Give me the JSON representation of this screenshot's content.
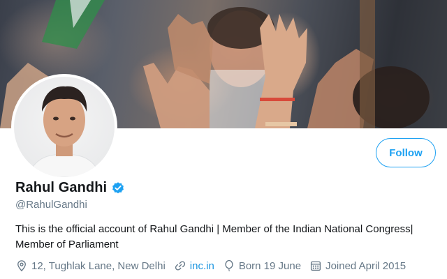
{
  "profile": {
    "name": "Rahul Gandhi",
    "handle": "@RahulGandhi",
    "bio": "This is the official account of Rahul Gandhi | Member of the Indian National Congress| Member of Parliament",
    "verified": true,
    "follow_label": "Follow",
    "location": "12, Tughlak Lane, New Delhi",
    "website": "inc.in",
    "birthday": "Born 19 June",
    "joined": "Joined April 2015"
  },
  "icons": {
    "verified": "verified-badge-icon",
    "location": "location-pin-icon",
    "website": "link-icon",
    "birthday": "balloon-icon",
    "joined": "calendar-icon"
  },
  "colors": {
    "accent": "#1da1f2",
    "link": "#1b95e0",
    "secondary_text": "#657786",
    "primary_text": "#14171a"
  }
}
